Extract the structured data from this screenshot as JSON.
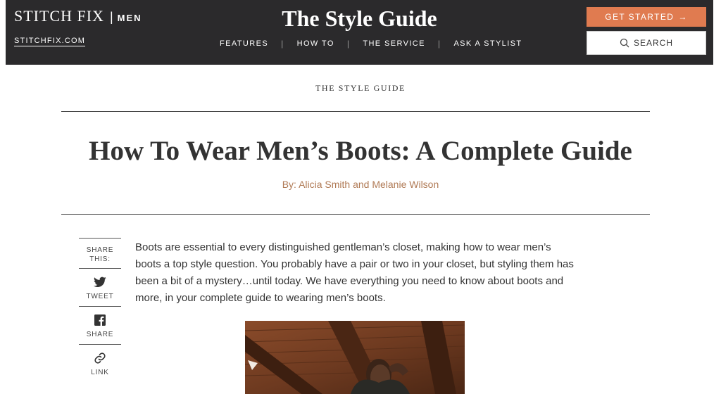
{
  "header": {
    "brand": "STITCH FIX",
    "brand_separator": "|",
    "brand_section": "MEN",
    "home_link": "STITCHFIX.COM",
    "guide_title": "The Style Guide",
    "nav": [
      "FEATURES",
      "HOW TO",
      "THE SERVICE",
      "ASK A STYLIST"
    ],
    "nav_separator": "|",
    "cta_label": "GET STARTED",
    "cta_arrow": "→",
    "search_label": "SEARCH",
    "accent_color": "#e07b50",
    "bg_color": "#2b2a2c"
  },
  "article": {
    "kicker": "THE STYLE GUIDE",
    "title": "How To Wear Men’s Boots: A Complete Guide",
    "byline": "By: Alicia Smith and Melanie Wilson",
    "byline_color": "#b07a55",
    "intro": "Boots are essential to every distinguished gentleman’s closet, making how to wear men’s boots a top style question. You probably have a pair or two in your closet, but styling them has been a bit of a mystery…until today. We have everything you need to know about boots and more, in your complete guide to wearing men’s boots."
  },
  "share": {
    "title_line1": "SHARE",
    "title_line2": "THIS:",
    "tweet": "TWEET",
    "facebook": "SHARE",
    "link": "LINK",
    "icons": [
      "twitter-icon",
      "facebook-icon",
      "link-icon"
    ]
  }
}
